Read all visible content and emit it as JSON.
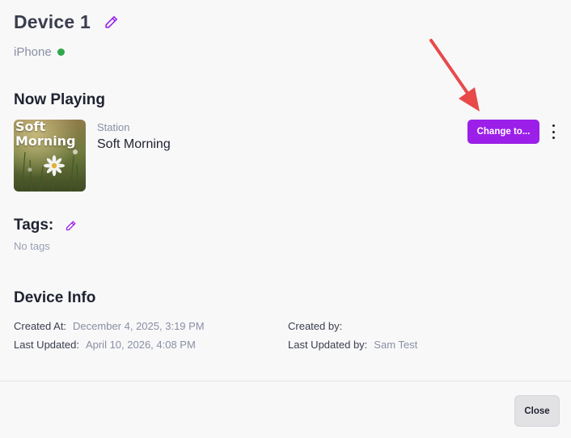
{
  "device": {
    "title": "Device 1",
    "platform": "iPhone",
    "status_color": "#2ea84a"
  },
  "now_playing": {
    "heading": "Now Playing",
    "cover_text": "Soft Morning",
    "station_label": "Station",
    "station_name": "Soft Morning",
    "change_button": "Change to..."
  },
  "tags": {
    "heading": "Tags:",
    "empty_text": "No tags"
  },
  "device_info": {
    "heading": "Device Info",
    "created_at_label": "Created At:",
    "created_at_value": "December 4, 2025, 3:19 PM",
    "last_updated_label": "Last Updated:",
    "last_updated_value": "April 10, 2026, 4:08 PM",
    "created_by_label": "Created by:",
    "created_by_value": "",
    "last_updated_by_label": "Last Updated by:",
    "last_updated_by_value": "Sam Test"
  },
  "footer": {
    "close_button": "Close"
  },
  "colors": {
    "accent": "#9b1fe8",
    "annotation_arrow": "#e84a4a"
  },
  "icons": [
    "pencil-icon",
    "kebab-menu-icon",
    "annotation-arrow-icon"
  ]
}
